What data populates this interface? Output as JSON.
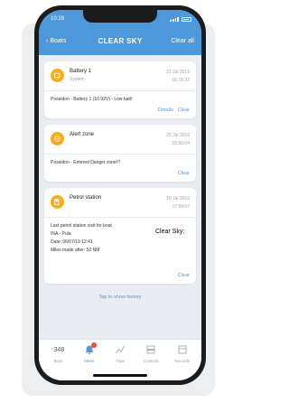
{
  "status_bar": {
    "time": "10:28"
  },
  "nav": {
    "back_label": "Boats",
    "title": "CLEAR SKY",
    "clear_all_label": "Clear all"
  },
  "alerts": [
    {
      "name": "Battery 1",
      "category": "System",
      "date": "21 Jul 2019",
      "time": "16:15:22",
      "message": "Poseidon - Battery 1 (10.92V) - Low batt!",
      "details_label": "Details",
      "clear_label": "Clear"
    },
    {
      "name": "Alert zone",
      "date": "20 Jul 2019",
      "time": "15:56:04",
      "message": "Poseidon - Entered Danger zone!!!",
      "clear_label": "Clear"
    },
    {
      "name": "Petrol station",
      "date": "10 Jul 2019",
      "time": "17:54:57",
      "message_lines": [
        "Last petrol station visit for boat",
        "INA - Pula",
        "Date: 06/07/19 12:41",
        "Miles made after: 52 NM"
      ],
      "clear_label": "Clear"
    }
  ],
  "history_label": "Tap to show history",
  "overlay_text": "Clear Sky:",
  "tabs": [
    {
      "value": "348",
      "label": "Boat",
      "icon": "gauge-icon"
    },
    {
      "label": "Alerts",
      "icon": "bell-icon"
    },
    {
      "label": "Trips",
      "icon": "trips-icon"
    },
    {
      "label": "Controls",
      "icon": "controls-icon"
    },
    {
      "label": "Records",
      "icon": "records-icon"
    }
  ],
  "colors": {
    "header": "#4c98db",
    "icon_bg": "#f6ac1e",
    "link": "#4c98db",
    "badge": "#e74c3c"
  }
}
